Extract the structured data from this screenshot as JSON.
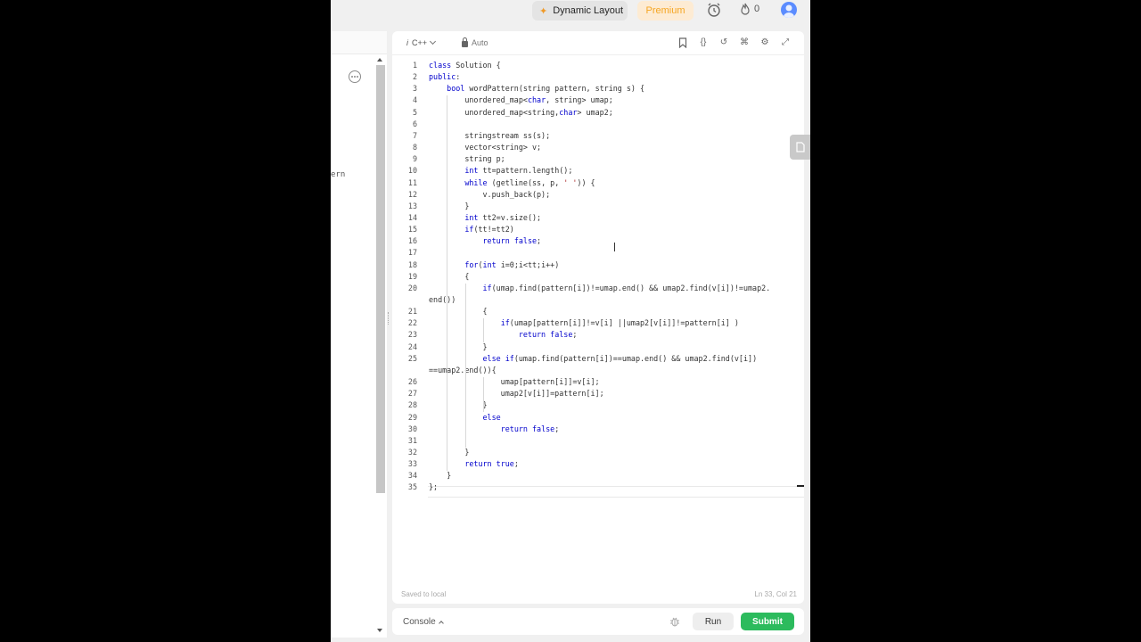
{
  "topbar": {
    "layout_label": "Dynamic Layout",
    "premium_label": "Premium",
    "streak_count": "0"
  },
  "left_panel": {
    "visible_text": "ern"
  },
  "editor": {
    "language": "C++",
    "mode": "Auto",
    "status_saved": "Saved to local",
    "cursor_position": "Ln 33, Col 21"
  },
  "code": {
    "line_numbers": [
      "1",
      "2",
      "3",
      "4",
      "5",
      "6",
      "7",
      "8",
      "9",
      "10",
      "11",
      "12",
      "13",
      "14",
      "15",
      "16",
      "17",
      "18",
      "19",
      "20",
      "",
      "21",
      "22",
      "23",
      "24",
      "25",
      "",
      "26",
      "27",
      "28",
      "29",
      "30",
      "31",
      "32",
      "33",
      "34",
      "35"
    ],
    "lines": [
      "class Solution {",
      "public:",
      "    bool wordPattern(string pattern, string s) {",
      "        unordered_map<char, string> umap;",
      "        unordered_map<string,char> umap2;",
      "",
      "        stringstream ss(s);",
      "        vector<string> v;",
      "        string p;",
      "        int tt=pattern.length();",
      "        while (getline(ss, p, ' ')) {",
      "            v.push_back(p);",
      "        }",
      "        int tt2=v.size();",
      "        if(tt!=tt2)",
      "            return false;",
      "",
      "        for(int i=0;i<tt;i++)",
      "        {",
      "            if(umap.find(pattern[i])!=umap.end() && umap2.find(v[i])!=umap2.",
      "end())",
      "            {",
      "                if(umap[pattern[i]]!=v[i] ||umap2[v[i]]!=pattern[i] )",
      "                    return false;",
      "            }",
      "            else if(umap.find(pattern[i])==umap.end() && umap2.find(v[i])",
      "==umap2.end()){",
      "                umap[pattern[i]]=v[i];",
      "                umap2[v[i]]=pattern[i];",
      "            }",
      "            else",
      "                return false;",
      "",
      "        }",
      "        return true;",
      "    }",
      "};"
    ]
  },
  "console": {
    "label": "Console",
    "run_label": "Run",
    "submit_label": "Submit"
  },
  "colors": {
    "submit": "#2cbb5d",
    "premium_text": "#f5a623",
    "premium_bg": "#fdebd3",
    "keyword": "#0000cc"
  }
}
